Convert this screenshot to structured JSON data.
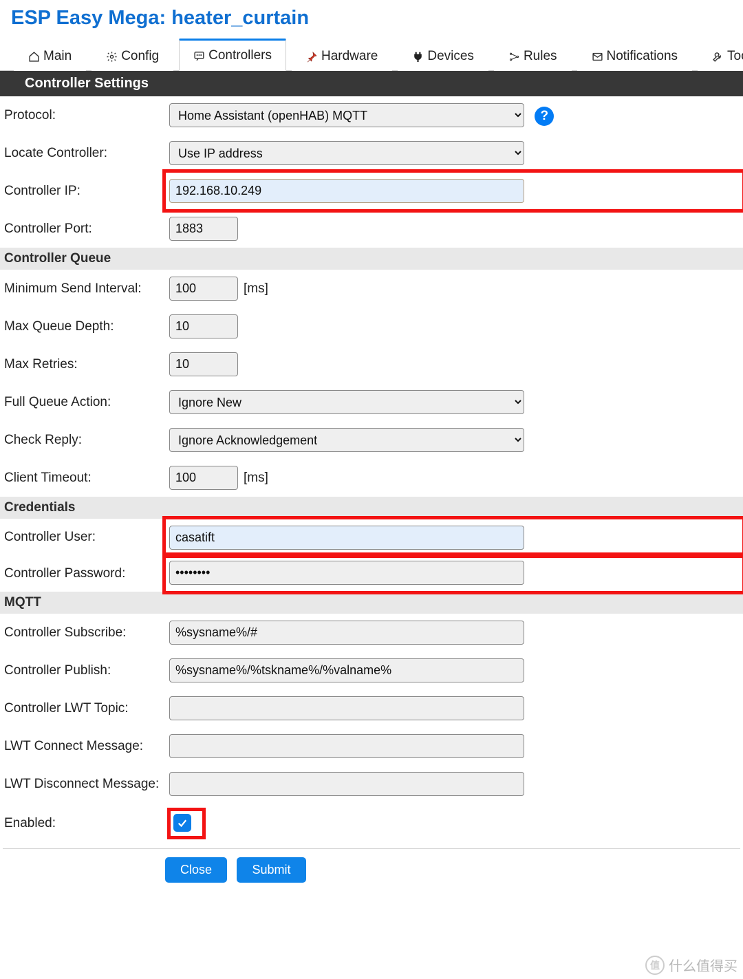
{
  "title": "ESP Easy Mega: heater_curtain",
  "tabs": {
    "main": "Main",
    "config": "Config",
    "controllers": "Controllers",
    "hardware": "Hardware",
    "devices": "Devices",
    "rules": "Rules",
    "notifications": "Notifications",
    "tools": "Tools"
  },
  "sections": {
    "controller_settings": "Controller Settings",
    "controller_queue": "Controller Queue",
    "credentials": "Credentials",
    "mqtt": "MQTT"
  },
  "labels": {
    "protocol": "Protocol:",
    "locate": "Locate Controller:",
    "ip": "Controller IP:",
    "port": "Controller Port:",
    "min_send": "Minimum Send Interval:",
    "max_queue": "Max Queue Depth:",
    "max_retries": "Max Retries:",
    "full_queue": "Full Queue Action:",
    "check_reply": "Check Reply:",
    "client_timeout": "Client Timeout:",
    "user": "Controller User:",
    "password": "Controller Password:",
    "subscribe": "Controller Subscribe:",
    "publish": "Controller Publish:",
    "lwt_topic": "Controller LWT Topic:",
    "lwt_connect": "LWT Connect Message:",
    "lwt_disconnect": "LWT Disconnect Message:",
    "enabled": "Enabled:",
    "ms": "[ms]"
  },
  "values": {
    "protocol": "Home Assistant (openHAB) MQTT",
    "locate": "Use IP address",
    "ip": "192.168.10.249",
    "port": "1883",
    "min_send": "100",
    "max_queue": "10",
    "max_retries": "10",
    "full_queue": "Ignore New",
    "check_reply": "Ignore Acknowledgement",
    "client_timeout": "100",
    "user": "casatift",
    "password": "••••••••",
    "subscribe": "%sysname%/#",
    "publish": "%sysname%/%tskname%/%valname%",
    "lwt_topic": "",
    "lwt_connect": "",
    "lwt_disconnect": "",
    "enabled": true
  },
  "buttons": {
    "close": "Close",
    "submit": "Submit"
  },
  "help": "?",
  "watermark": "什么值得买"
}
